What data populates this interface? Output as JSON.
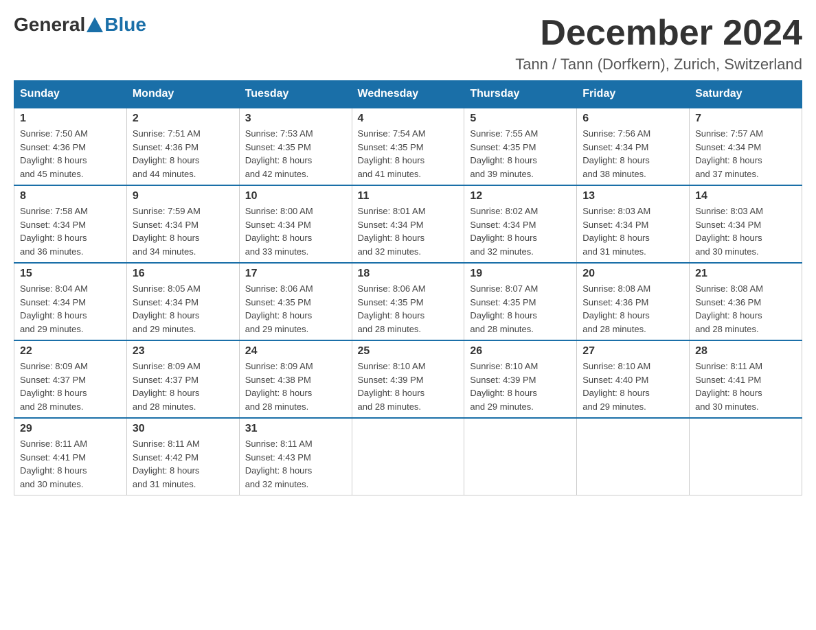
{
  "header": {
    "logo_general": "General",
    "logo_blue": "Blue",
    "month_title": "December 2024",
    "subtitle": "Tann / Tann (Dorfkern), Zurich, Switzerland"
  },
  "weekdays": [
    "Sunday",
    "Monday",
    "Tuesday",
    "Wednesday",
    "Thursday",
    "Friday",
    "Saturday"
  ],
  "weeks": [
    [
      {
        "day": "1",
        "sunrise": "7:50 AM",
        "sunset": "4:36 PM",
        "daylight": "8 hours and 45 minutes."
      },
      {
        "day": "2",
        "sunrise": "7:51 AM",
        "sunset": "4:36 PM",
        "daylight": "8 hours and 44 minutes."
      },
      {
        "day": "3",
        "sunrise": "7:53 AM",
        "sunset": "4:35 PM",
        "daylight": "8 hours and 42 minutes."
      },
      {
        "day": "4",
        "sunrise": "7:54 AM",
        "sunset": "4:35 PM",
        "daylight": "8 hours and 41 minutes."
      },
      {
        "day": "5",
        "sunrise": "7:55 AM",
        "sunset": "4:35 PM",
        "daylight": "8 hours and 39 minutes."
      },
      {
        "day": "6",
        "sunrise": "7:56 AM",
        "sunset": "4:34 PM",
        "daylight": "8 hours and 38 minutes."
      },
      {
        "day": "7",
        "sunrise": "7:57 AM",
        "sunset": "4:34 PM",
        "daylight": "8 hours and 37 minutes."
      }
    ],
    [
      {
        "day": "8",
        "sunrise": "7:58 AM",
        "sunset": "4:34 PM",
        "daylight": "8 hours and 36 minutes."
      },
      {
        "day": "9",
        "sunrise": "7:59 AM",
        "sunset": "4:34 PM",
        "daylight": "8 hours and 34 minutes."
      },
      {
        "day": "10",
        "sunrise": "8:00 AM",
        "sunset": "4:34 PM",
        "daylight": "8 hours and 33 minutes."
      },
      {
        "day": "11",
        "sunrise": "8:01 AM",
        "sunset": "4:34 PM",
        "daylight": "8 hours and 32 minutes."
      },
      {
        "day": "12",
        "sunrise": "8:02 AM",
        "sunset": "4:34 PM",
        "daylight": "8 hours and 32 minutes."
      },
      {
        "day": "13",
        "sunrise": "8:03 AM",
        "sunset": "4:34 PM",
        "daylight": "8 hours and 31 minutes."
      },
      {
        "day": "14",
        "sunrise": "8:03 AM",
        "sunset": "4:34 PM",
        "daylight": "8 hours and 30 minutes."
      }
    ],
    [
      {
        "day": "15",
        "sunrise": "8:04 AM",
        "sunset": "4:34 PM",
        "daylight": "8 hours and 29 minutes."
      },
      {
        "day": "16",
        "sunrise": "8:05 AM",
        "sunset": "4:34 PM",
        "daylight": "8 hours and 29 minutes."
      },
      {
        "day": "17",
        "sunrise": "8:06 AM",
        "sunset": "4:35 PM",
        "daylight": "8 hours and 29 minutes."
      },
      {
        "day": "18",
        "sunrise": "8:06 AM",
        "sunset": "4:35 PM",
        "daylight": "8 hours and 28 minutes."
      },
      {
        "day": "19",
        "sunrise": "8:07 AM",
        "sunset": "4:35 PM",
        "daylight": "8 hours and 28 minutes."
      },
      {
        "day": "20",
        "sunrise": "8:08 AM",
        "sunset": "4:36 PM",
        "daylight": "8 hours and 28 minutes."
      },
      {
        "day": "21",
        "sunrise": "8:08 AM",
        "sunset": "4:36 PM",
        "daylight": "8 hours and 28 minutes."
      }
    ],
    [
      {
        "day": "22",
        "sunrise": "8:09 AM",
        "sunset": "4:37 PM",
        "daylight": "8 hours and 28 minutes."
      },
      {
        "day": "23",
        "sunrise": "8:09 AM",
        "sunset": "4:37 PM",
        "daylight": "8 hours and 28 minutes."
      },
      {
        "day": "24",
        "sunrise": "8:09 AM",
        "sunset": "4:38 PM",
        "daylight": "8 hours and 28 minutes."
      },
      {
        "day": "25",
        "sunrise": "8:10 AM",
        "sunset": "4:39 PM",
        "daylight": "8 hours and 28 minutes."
      },
      {
        "day": "26",
        "sunrise": "8:10 AM",
        "sunset": "4:39 PM",
        "daylight": "8 hours and 29 minutes."
      },
      {
        "day": "27",
        "sunrise": "8:10 AM",
        "sunset": "4:40 PM",
        "daylight": "8 hours and 29 minutes."
      },
      {
        "day": "28",
        "sunrise": "8:11 AM",
        "sunset": "4:41 PM",
        "daylight": "8 hours and 30 minutes."
      }
    ],
    [
      {
        "day": "29",
        "sunrise": "8:11 AM",
        "sunset": "4:41 PM",
        "daylight": "8 hours and 30 minutes."
      },
      {
        "day": "30",
        "sunrise": "8:11 AM",
        "sunset": "4:42 PM",
        "daylight": "8 hours and 31 minutes."
      },
      {
        "day": "31",
        "sunrise": "8:11 AM",
        "sunset": "4:43 PM",
        "daylight": "8 hours and 32 minutes."
      },
      null,
      null,
      null,
      null
    ]
  ],
  "labels": {
    "sunrise": "Sunrise:",
    "sunset": "Sunset:",
    "daylight": "Daylight:"
  }
}
